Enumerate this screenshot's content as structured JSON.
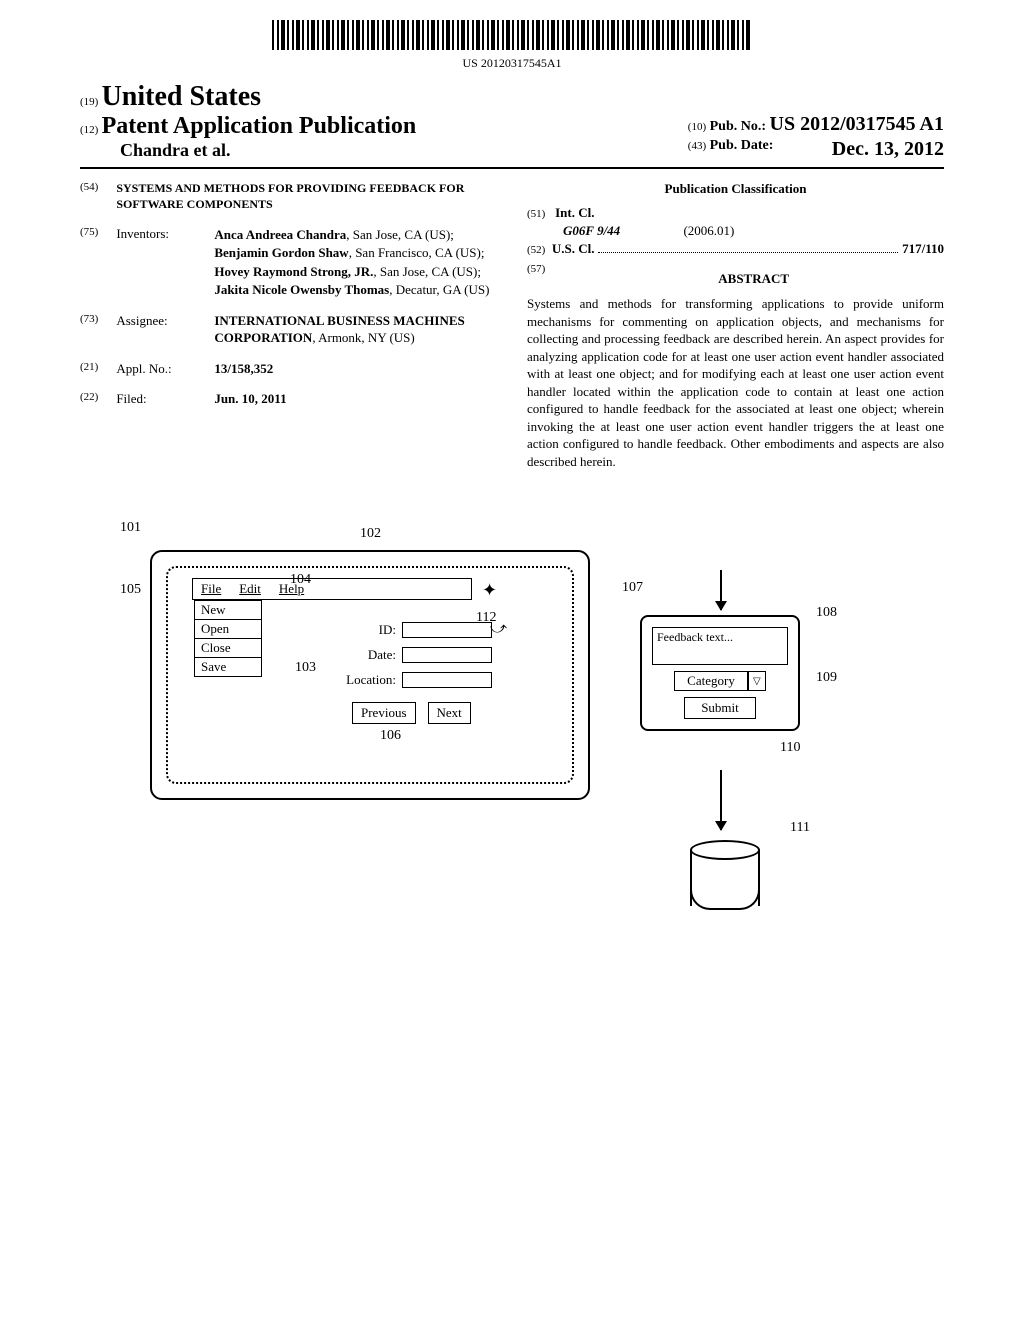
{
  "barcode_number": "US 20120317545A1",
  "header": {
    "code_19": "(19)",
    "country": "United States",
    "code_12": "(12)",
    "pub_type": "Patent Application Publication",
    "authors_line": "Chandra et al.",
    "code_10": "(10)",
    "pub_no_label": "Pub. No.:",
    "pub_no_value": "US 2012/0317545 A1",
    "code_43": "(43)",
    "pub_date_label": "Pub. Date:",
    "pub_date_value": "Dec. 13, 2012"
  },
  "left_col": {
    "code_54": "(54)",
    "title": "SYSTEMS AND METHODS FOR PROVIDING FEEDBACK FOR SOFTWARE COMPONENTS",
    "code_75": "(75)",
    "inventors_label": "Inventors:",
    "inventors_html_parts": {
      "n1": "Anca Andreea Chandra",
      "l1": ", San Jose, CA (US); ",
      "n2": "Benjamin Gordon Shaw",
      "l2": ", San Francisco, CA (US); ",
      "n3": "Hovey Raymond Strong, JR.",
      "l3": ", San Jose, CA (US); ",
      "n4": "Jakita Nicole Owensby Thomas",
      "l4": ", Decatur, GA (US)"
    },
    "code_73": "(73)",
    "assignee_label": "Assignee:",
    "assignee_name": "INTERNATIONAL BUSINESS MACHINES CORPORATION",
    "assignee_loc": ", Armonk, NY (US)",
    "code_21": "(21)",
    "appl_no_label": "Appl. No.:",
    "appl_no_value": "13/158,352",
    "code_22": "(22)",
    "filed_label": "Filed:",
    "filed_value": "Jun. 10, 2011"
  },
  "right_col": {
    "classification_header": "Publication Classification",
    "code_51": "(51)",
    "int_cl_label": "Int. Cl.",
    "int_cl_code": "G06F 9/44",
    "int_cl_date": "(2006.01)",
    "code_52": "(52)",
    "us_cl_label": "U.S. Cl.",
    "us_cl_value": "717/110",
    "code_57": "(57)",
    "abstract_header": "ABSTRACT",
    "abstract_text": "Systems and methods for transforming applications to provide uniform mechanisms for commenting on application objects, and mechanisms for collecting and processing feedback are described herein. An aspect provides for analyzing application code for at least one user action event handler associated with at least one object; and for modifying each at least one user action event handler located within the application code to contain at least one action configured to handle feedback for the associated at least one object; wherein invoking the at least one user action event handler triggers the at least one action configured to handle feedback. Other embodiments and aspects are also described herein."
  },
  "figure": {
    "refs": {
      "r101": "101",
      "r102": "102",
      "r103": "103",
      "r104": "104",
      "r105": "105",
      "r106": "106",
      "r107": "107",
      "r108": "108",
      "r109": "109",
      "r110": "110",
      "r111": "111",
      "r112": "112"
    },
    "menubar": {
      "file": "File",
      "edit": "Edit",
      "help": "Help"
    },
    "file_menu": {
      "new": "New",
      "open": "Open",
      "close": "Close",
      "save": "Save"
    },
    "form": {
      "id_label": "ID:",
      "date_label": "Date:",
      "location_label": "Location:"
    },
    "buttons": {
      "previous": "Previous",
      "next": "Next"
    },
    "feedback": {
      "placeholder": "Feedback text...",
      "category": "Category",
      "submit": "Submit"
    }
  }
}
